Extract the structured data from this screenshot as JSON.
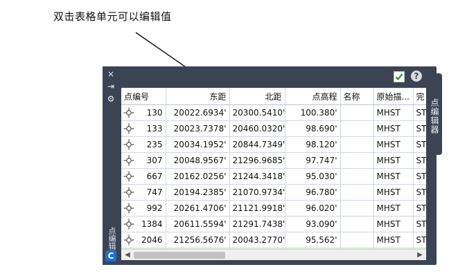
{
  "annotation": {
    "text": "双击表格单元可以编辑值"
  },
  "palette": {
    "title": "点编辑器",
    "side_tab_label": "点编辑器",
    "close_icon": "×",
    "autohide_icon": "⇥",
    "settings_icon": "⚙",
    "logo_letter": "C",
    "help_label": "?"
  },
  "table": {
    "columns": [
      "点编号",
      "东距",
      "北距",
      "点高程",
      "名称",
      "原始描...",
      "完"
    ],
    "rows": [
      [
        "130",
        "20022.6934'",
        "20300.5410'",
        "100.380'",
        "",
        "MHST",
        "ST"
      ],
      [
        "133",
        "20023.7378'",
        "20460.0320'",
        "98.690'",
        "",
        "MHST",
        "ST"
      ],
      [
        "235",
        "20034.1952'",
        "20844.7349'",
        "98.120'",
        "",
        "MHST",
        "ST"
      ],
      [
        "307",
        "20048.9567'",
        "21296.9685'",
        "97.747'",
        "",
        "MHST",
        "ST"
      ],
      [
        "667",
        "20162.0256'",
        "21244.3418'",
        "95.030'",
        "",
        "MHST",
        "ST"
      ],
      [
        "747",
        "20194.2385'",
        "21070.9734'",
        "96.780'",
        "",
        "MHST",
        "ST"
      ],
      [
        "992",
        "20261.4706'",
        "21121.9918'",
        "96.020'",
        "",
        "MHST",
        "ST"
      ],
      [
        "1384",
        "20611.5594'",
        "21291.7438'",
        "93.090'",
        "",
        "MHST",
        "ST"
      ],
      [
        "2046",
        "21256.5676'",
        "20043.2770'",
        "95.562'",
        "",
        "MHST",
        "ST"
      ]
    ]
  },
  "colors": {
    "palette_bg": "#3c4453",
    "new_row": "#d9f7d3",
    "accept_check": "#2e9b3a"
  }
}
